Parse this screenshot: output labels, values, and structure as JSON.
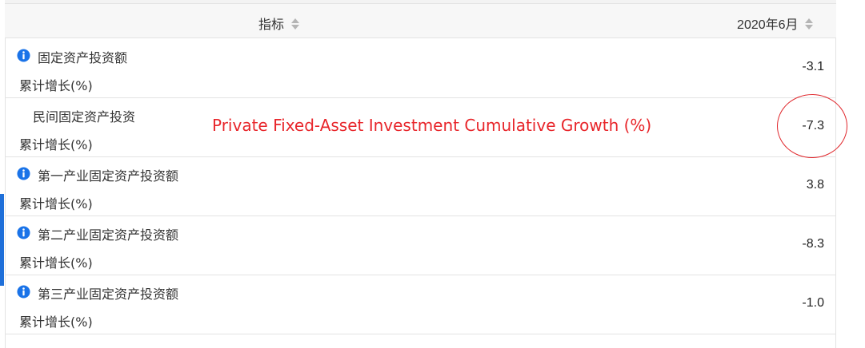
{
  "header": {
    "indicator_label": "指标",
    "date_label": "2020年6月"
  },
  "rows": [
    {
      "name": "固定资产投资额",
      "unit": "累计增长(%)",
      "value": "-3.1",
      "has_info": true
    },
    {
      "name": "民间固定资产投资",
      "unit": "累计增长(%)",
      "value": "-7.3",
      "has_info": false
    },
    {
      "name": "第一产业固定资产投资额",
      "unit": "累计增长(%)",
      "value": "3.8",
      "has_info": true
    },
    {
      "name": "第二产业固定资产投资额",
      "unit": "累计增长(%)",
      "value": "-8.3",
      "has_info": true
    },
    {
      "name": "第三产业固定资产投资额",
      "unit": "累计增长(%)",
      "value": "-1.0",
      "has_info": true
    }
  ],
  "annotation": {
    "text": "Private Fixed-Asset Investment Cumulative Growth (%)",
    "color": "#e8262b"
  },
  "colors": {
    "info_icon": "#1a73e8",
    "accent": "#1e6fd9"
  },
  "icons": {
    "info": "info-circle-icon",
    "sort": "sort-arrows-icon"
  }
}
